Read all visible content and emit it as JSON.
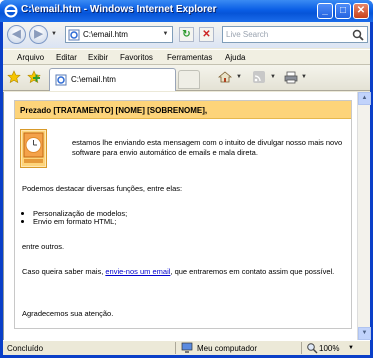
{
  "window": {
    "title": "C:\\email.htm - Windows Internet Explorer",
    "controls": {
      "minimize": "_",
      "maximize": "□",
      "close": "✕"
    }
  },
  "navbar": {
    "back_glyph": "◀",
    "forward_glyph": "▶",
    "address": "C:\\email.htm",
    "refresh_glyph": "↻",
    "stop_glyph": "✕",
    "search_placeholder": "Live Search"
  },
  "menu": [
    "Arquivo",
    "Editar",
    "Exibir",
    "Favoritos",
    "Ferramentas",
    "Ajuda"
  ],
  "tab": {
    "label": "C:\\email.htm"
  },
  "email": {
    "greeting": "Prezado [TRATAMENTO] [NOME] [SOBRENOME],",
    "intro": "estamos lhe enviando esta mensagem com o intuito de divulgar nosso mais novo software para envio automático de emails e mala direta.",
    "features_intro": "Podemos destacar diversas funções, entre elas:",
    "features": [
      "Personalização de modelos;",
      "Envio em formato HTML;"
    ],
    "others": "entre outros.",
    "contact_prefix": "Caso queira saber mais, ",
    "contact_link": "envie-nos um email",
    "contact_suffix": ", que entraremos em contato assim que possível.",
    "thanks": "Agradecemos sua atenção."
  },
  "statusbar": {
    "status": "Concluído",
    "zone": "Meu computador",
    "zoom": "100%"
  },
  "colors": {
    "title_bar": "#0a5ee5",
    "header_band": "#fdd47a",
    "link": "#0000cc"
  }
}
